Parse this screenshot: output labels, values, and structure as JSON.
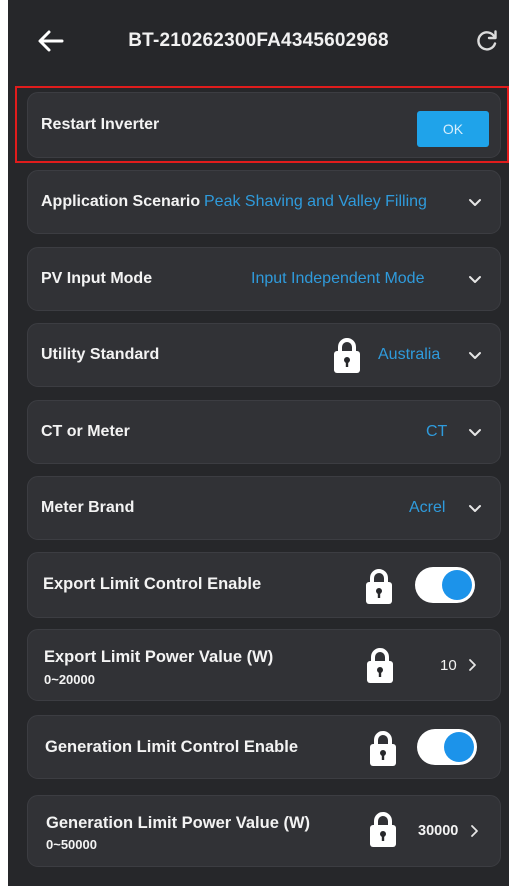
{
  "header": {
    "title": "BT-210262300FA4345602968",
    "back_icon": "arrow-left-icon",
    "refresh_icon": "refresh-icon"
  },
  "colors": {
    "background": "#26272a",
    "card": "#313236",
    "accent": "#1fa3ea",
    "value_text": "#2f9bdc",
    "highlight_border": "#e01c1c"
  },
  "settings": {
    "restart": {
      "label": "Restart Inverter",
      "button": "OK"
    },
    "scenario": {
      "label": "Application Scenario",
      "value": "Peak Shaving and Valley Filling"
    },
    "pv_mode": {
      "label": "PV Input Mode",
      "value": "Input Independent Mode"
    },
    "utility": {
      "label": "Utility Standard",
      "value": "Australia",
      "locked": true
    },
    "ct_meter": {
      "label": "CT or Meter",
      "value": "CT"
    },
    "meter_brand": {
      "label": "Meter Brand",
      "value": "Acrel"
    },
    "export_enable": {
      "label": "Export Limit Control Enable",
      "enabled": true,
      "locked": true
    },
    "export_power": {
      "label": "Export Limit Power Value (W)",
      "range": "0~20000",
      "value": "10",
      "locked": true
    },
    "gen_enable": {
      "label": "Generation Limit Control Enable",
      "enabled": true,
      "locked": true
    },
    "gen_power": {
      "label": "Generation Limit Power Value (W)",
      "range": "0~50000",
      "value": "30000",
      "locked": true
    }
  }
}
